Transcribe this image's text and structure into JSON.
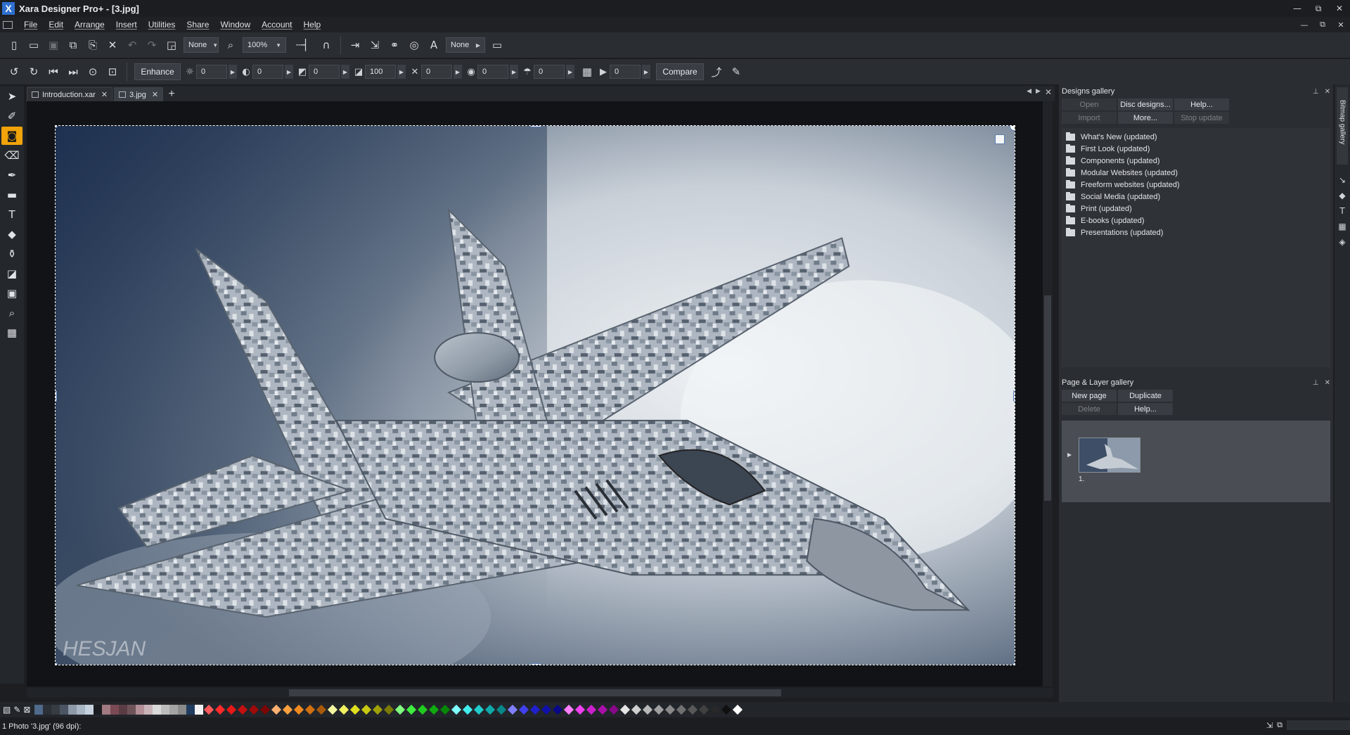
{
  "window": {
    "title": "Xara Designer Pro+ - [3.jpg]",
    "logo": "X",
    "controls": [
      "—",
      "⧉",
      "✕"
    ],
    "doc_controls": [
      "—",
      "⧉",
      "✕"
    ]
  },
  "menu": [
    "File",
    "Edit",
    "Arrange",
    "Insert",
    "Utilities",
    "Share",
    "Window",
    "Account",
    "Help"
  ],
  "toolbar1": {
    "new_icon": "new-document-icon",
    "open_icon": "open-folder-icon",
    "save_icon": "save-icon",
    "quality_value": "None",
    "zoom_value": "100%",
    "feather_value": "None"
  },
  "toolbar2": {
    "enhance_label": "Enhance",
    "compare_label": "Compare",
    "adjustments": [
      {
        "name": "brightness",
        "icon": "☼",
        "value": "0"
      },
      {
        "name": "contrast",
        "icon": "◐",
        "value": "0"
      },
      {
        "name": "saturation",
        "icon": "◩",
        "value": "0"
      },
      {
        "name": "temperature",
        "icon": "◪",
        "value": "100"
      },
      {
        "name": "sharpen",
        "icon": "✕",
        "value": "0"
      },
      {
        "name": "vignette",
        "icon": "◉",
        "value": "0"
      },
      {
        "name": "tint",
        "icon": "☂",
        "value": "0"
      },
      {
        "name": "levels",
        "icon": "▶",
        "value": "0"
      }
    ]
  },
  "tabs": [
    {
      "label": "Introduction.xar",
      "close": "✕"
    },
    {
      "label": "3.jpg",
      "close": "✕"
    }
  ],
  "tab_add": "+",
  "designs_gallery": {
    "title": "Designs gallery",
    "buttons_row1": [
      "Open",
      "Disc designs...",
      "Help..."
    ],
    "buttons_row2": [
      "Import",
      "More...",
      "Stop update"
    ],
    "folders": [
      "What's New (updated)",
      "First Look (updated)",
      "Components (updated)",
      "Modular Websites (updated)",
      "Freeform websites (updated)",
      "Social Media (updated)",
      "Print (updated)",
      "E-books (updated)",
      "Presentations (updated)"
    ]
  },
  "page_layer_gallery": {
    "title": "Page & Layer gallery",
    "buttons_row1": [
      "New page",
      "Duplicate"
    ],
    "buttons_row2": [
      "Delete",
      "Help..."
    ],
    "page_number": "1."
  },
  "side_tab": "Bitmap gallery",
  "watermark": "HESJAN",
  "status": {
    "text": "1 Photo '3.jpg' (96 dpi):"
  },
  "colors": {
    "accent": "#f0a30a",
    "selection": "#ffffff"
  }
}
